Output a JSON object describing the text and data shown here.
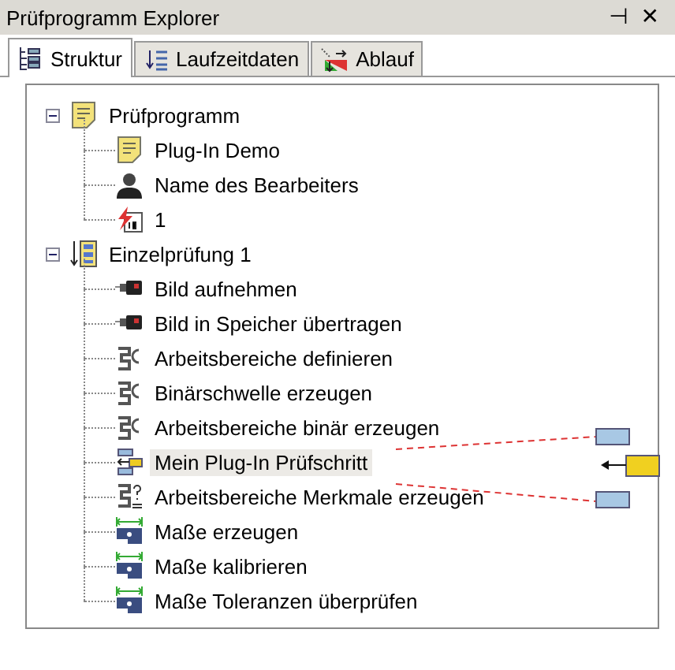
{
  "window": {
    "title": "Prüfprogramm Explorer",
    "pin": "⊣",
    "close": "✕"
  },
  "tabs": [
    {
      "label": "Struktur",
      "kind": "structure",
      "selected": true
    },
    {
      "label": "Laufzeitdaten",
      "kind": "runtime",
      "selected": false
    },
    {
      "label": "Ablauf",
      "kind": "flow",
      "selected": false
    }
  ],
  "tree": [
    {
      "label": "Prüfprogramm",
      "kind": "program",
      "expanded": true,
      "selected": false,
      "children": [
        {
          "label": "Plug-In Demo",
          "kind": "document",
          "selected": false
        },
        {
          "label": "Name des Bearbeiters",
          "kind": "person",
          "selected": false
        },
        {
          "label": "1",
          "kind": "id",
          "selected": false
        }
      ]
    },
    {
      "label": "Einzelprüfung 1",
      "kind": "test",
      "expanded": true,
      "selected": false,
      "children": [
        {
          "label": "Bild aufnehmen",
          "kind": "camera",
          "selected": false
        },
        {
          "label": "Bild in Speicher übertragen",
          "kind": "camera",
          "selected": false
        },
        {
          "label": "Arbeitsbereiche definieren",
          "kind": "region",
          "selected": false
        },
        {
          "label": "Binärschwelle erzeugen",
          "kind": "region",
          "selected": false
        },
        {
          "label": "Arbeitsbereiche binär erzeugen",
          "kind": "region",
          "selected": false
        },
        {
          "label": "Mein Plug-In Prüfschritt",
          "kind": "plugin",
          "selected": true
        },
        {
          "label": "Arbeitsbereiche Merkmale erzeugen",
          "kind": "features",
          "selected": false
        },
        {
          "label": "Maße erzeugen",
          "kind": "measure",
          "selected": false
        },
        {
          "label": "Maße kalibrieren",
          "kind": "measure",
          "selected": false
        },
        {
          "label": "Maße Toleranzen überprüfen",
          "kind": "measure",
          "selected": false
        }
      ]
    }
  ]
}
